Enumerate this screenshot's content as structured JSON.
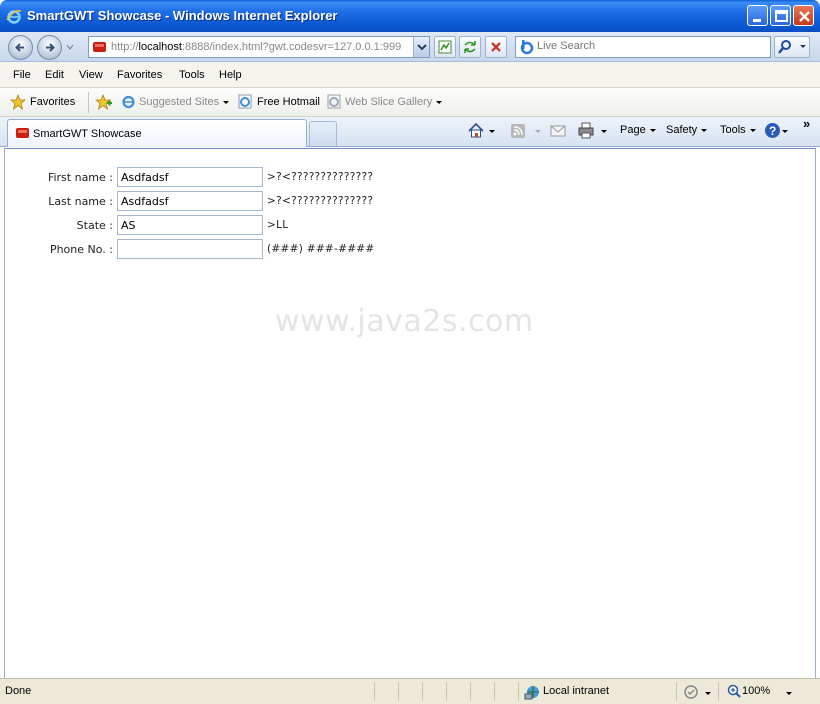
{
  "window": {
    "title": "SmartGWT Showcase - Windows Internet Explorer"
  },
  "address_bar": {
    "url_prefix": "http://",
    "url_host": "localhost",
    "url_rest": ":8888/index.html?gwt.codesvr=127.0.0.1:999",
    "search_placeholder": "Live Search"
  },
  "menu": {
    "items": [
      "File",
      "Edit",
      "View",
      "Favorites",
      "Tools",
      "Help"
    ]
  },
  "favorites_bar": {
    "favorites_label": "Favorites",
    "suggested_sites": "Suggested Sites",
    "free_hotmail": "Free Hotmail",
    "web_slice_gallery": "Web Slice Gallery"
  },
  "tabs": {
    "active_label": "SmartGWT Showcase"
  },
  "command_bar": {
    "page": "Page",
    "safety": "Safety",
    "tools": "Tools",
    "chevron": "»"
  },
  "form": {
    "rows": [
      {
        "label": "First name :",
        "value": "Asdfadsf",
        "mask": ">?<??????????????"
      },
      {
        "label": "Last name :",
        "value": "Asdfadsf",
        "mask": ">?<??????????????"
      },
      {
        "label": "State :",
        "value": "AS",
        "mask": ">LL"
      },
      {
        "label": "Phone No. :",
        "value": "",
        "mask": "(###) ###-####"
      }
    ]
  },
  "watermark": "www.java2s.com",
  "status_bar": {
    "status": "Done",
    "zone": "Local intranet",
    "zoom": "100%"
  }
}
